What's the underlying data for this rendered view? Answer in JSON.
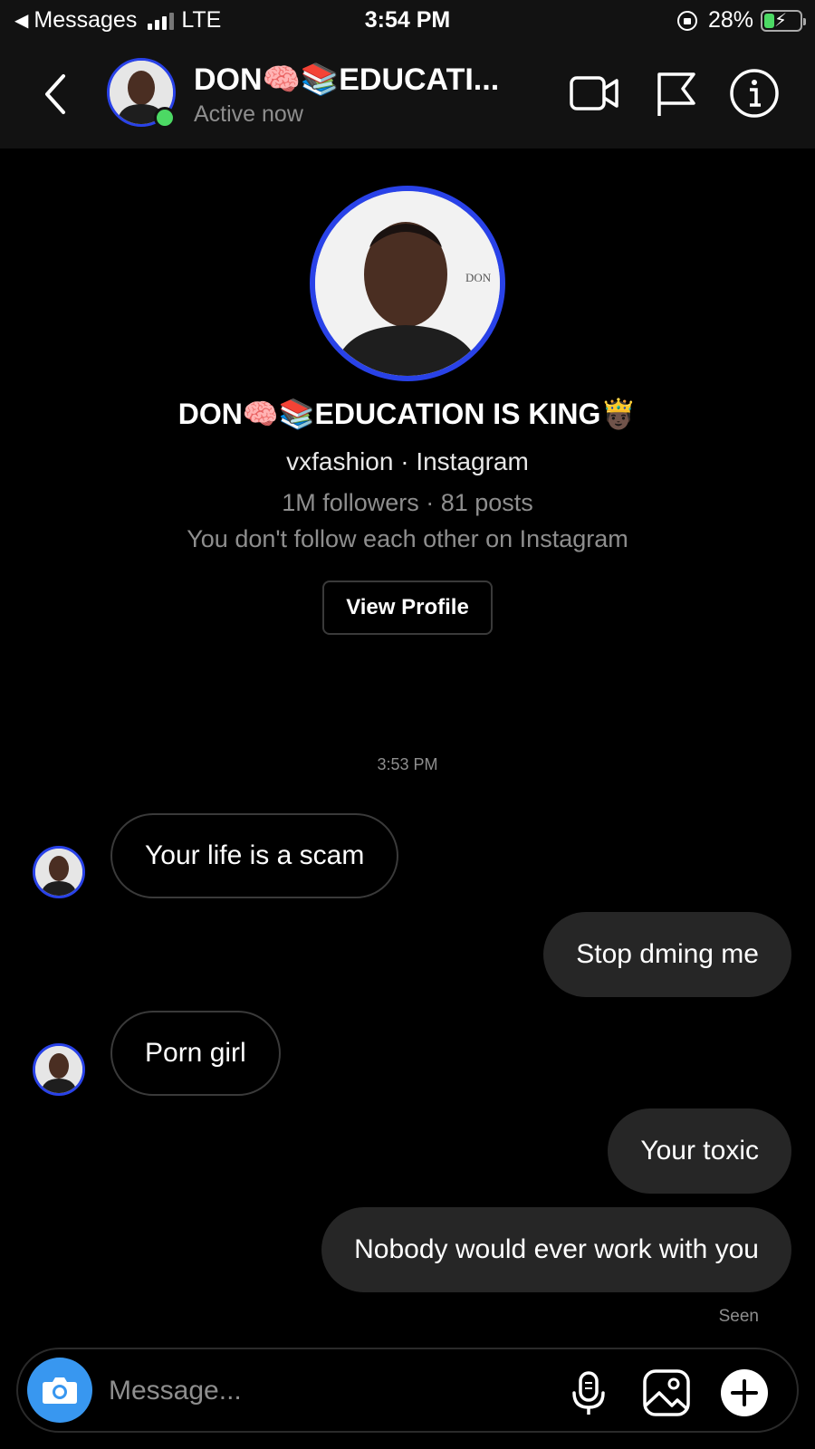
{
  "status_bar": {
    "back_app": "Messages",
    "network": "LTE",
    "time": "3:54 PM",
    "battery": "28%",
    "battery_level": 0.28
  },
  "header": {
    "name": "DON🧠📚EDUCATI...",
    "status": "Active now",
    "icons": [
      "chevron-left-icon",
      "video-camera-icon",
      "flag-icon",
      "info-icon"
    ]
  },
  "profile": {
    "avatar_text": "DON",
    "name": "DON🧠📚EDUCATION IS KING🤴🏿",
    "handle": "vxfashion · Instagram",
    "stats": "1M followers · 81 posts",
    "relation": "You don't follow each other on Instagram",
    "view_profile_label": "View Profile"
  },
  "thread": {
    "timestamp": "3:53 PM",
    "messages": [
      {
        "sender": "them",
        "text": "Your life is a scam"
      },
      {
        "sender": "me",
        "text": "Stop dming me"
      },
      {
        "sender": "them",
        "text": "Porn girl"
      },
      {
        "sender": "me",
        "text": "Your toxic"
      },
      {
        "sender": "me",
        "text": "Nobody would ever work with you"
      }
    ],
    "seen_label": "Seen"
  },
  "composer": {
    "placeholder": "Message...",
    "icons": [
      "camera-icon",
      "microphone-icon",
      "gallery-icon",
      "plus-icon"
    ]
  },
  "colors": {
    "background": "#000000",
    "bar_background": "#121212",
    "outgoing_bubble": "#262626",
    "camera_button": "#3897f0",
    "online": "#4cd964",
    "story_ring": "#2942e8"
  }
}
